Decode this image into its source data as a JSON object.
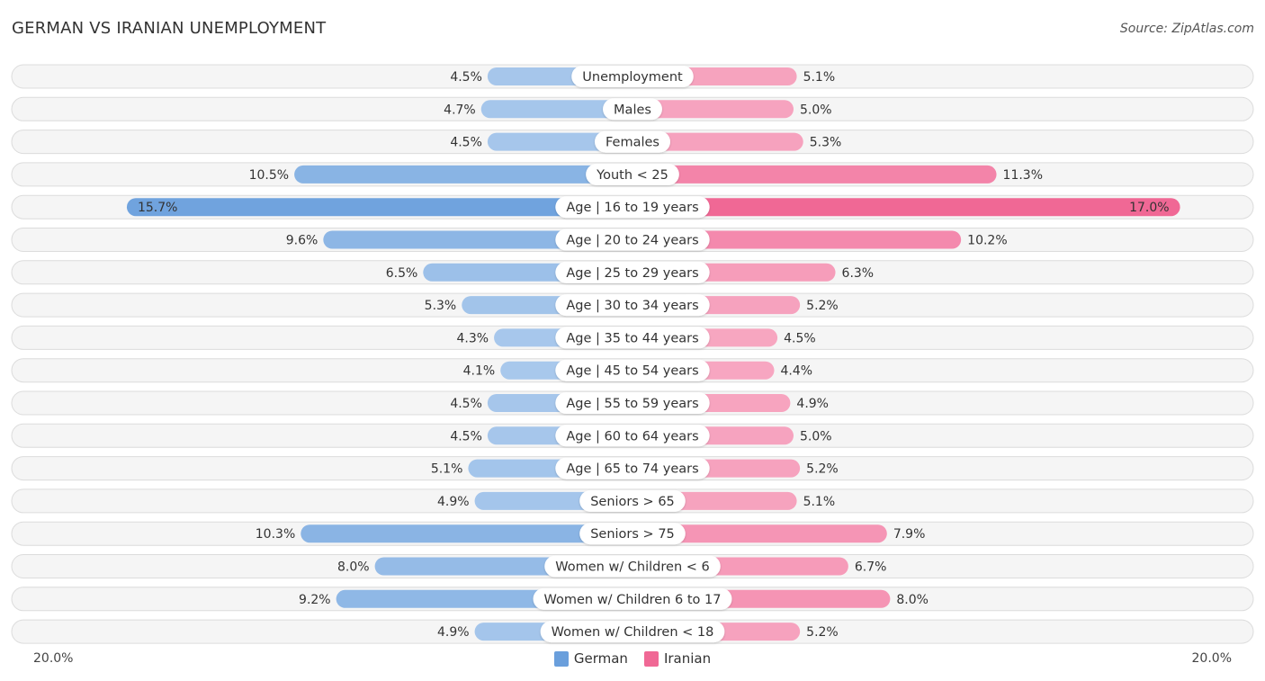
{
  "header": {
    "title": "GERMAN VS IRANIAN UNEMPLOYMENT",
    "source": "Source: ZipAtlas.com"
  },
  "chart_data": {
    "type": "bar",
    "orientation": "horizontal-diverging",
    "title": "GERMAN VS IRANIAN UNEMPLOYMENT",
    "xlabel": "",
    "ylabel": "",
    "xlim": [
      -20.0,
      20.0
    ],
    "axis_labels": {
      "left": "20.0%",
      "right": "20.0%"
    },
    "legend_position": "bottom-center",
    "categories": [
      "Unemployment",
      "Males",
      "Females",
      "Youth < 25",
      "Age | 16 to 19 years",
      "Age | 20 to 24 years",
      "Age | 25 to 29 years",
      "Age | 30 to 34 years",
      "Age | 35 to 44 years",
      "Age | 45 to 54 years",
      "Age | 55 to 59 years",
      "Age | 60 to 64 years",
      "Age | 65 to 74 years",
      "Seniors > 65",
      "Seniors > 75",
      "Women w/ Children < 6",
      "Women w/ Children 6 to 17",
      "Women w/ Children < 18"
    ],
    "series": [
      {
        "name": "German",
        "color": "#6a9fdc",
        "light_color": "#a8c8ec",
        "side": "left",
        "values": [
          4.5,
          4.7,
          4.5,
          10.5,
          15.7,
          9.6,
          6.5,
          5.3,
          4.3,
          4.1,
          4.5,
          4.5,
          5.1,
          4.9,
          10.3,
          8.0,
          9.2,
          4.9
        ],
        "labels": [
          "4.5%",
          "4.7%",
          "4.5%",
          "10.5%",
          "15.7%",
          "9.6%",
          "6.5%",
          "5.3%",
          "4.3%",
          "4.1%",
          "4.5%",
          "4.5%",
          "5.1%",
          "4.9%",
          "10.3%",
          "8.0%",
          "9.2%",
          "4.9%"
        ]
      },
      {
        "name": "Iranian",
        "color": "#f06895",
        "light_color": "#f7a8c2",
        "side": "right",
        "values": [
          5.1,
          5.0,
          5.3,
          11.3,
          17.0,
          10.2,
          6.3,
          5.2,
          4.5,
          4.4,
          4.9,
          5.0,
          5.2,
          5.1,
          7.9,
          6.7,
          8.0,
          5.2
        ],
        "labels": [
          "5.1%",
          "5.0%",
          "5.3%",
          "11.3%",
          "17.0%",
          "10.2%",
          "6.3%",
          "5.2%",
          "4.5%",
          "4.4%",
          "4.9%",
          "5.0%",
          "5.2%",
          "5.1%",
          "7.9%",
          "6.7%",
          "8.0%",
          "5.2%"
        ]
      }
    ]
  },
  "legend": {
    "items": [
      {
        "label": "German",
        "color": "#6a9fdc"
      },
      {
        "label": "Iranian",
        "color": "#f06895"
      }
    ]
  }
}
